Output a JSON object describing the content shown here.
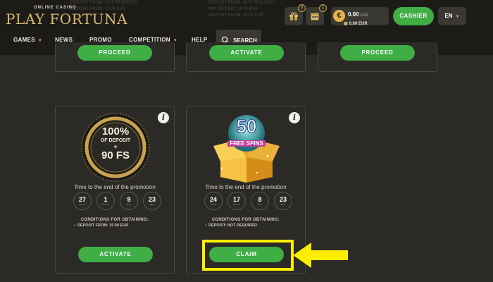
{
  "header": {
    "logo_small": "ONLINE CASINO",
    "logo_big": "PLAY FORTUNA",
    "gift_badge": "0",
    "calendar_badge": "1",
    "balance_amount": "0.00",
    "balance_currency": "EUR",
    "bonus_balance": "0.00 EUR",
    "cashier_label": "CASHIER",
    "language": "EN",
    "faded_rows_left": [
      "DEPOSIT FROM: NOT REQUIRED",
      "DEPOSIT FROM: 10.00 EUR"
    ],
    "faded_rows_mid": [
      "DEPOSIT FROM: NOT REQUIRED",
      "MIN DEPOSIT: 10.00 EUR",
      "DEPOSIT FROM: 10.00 EUR"
    ]
  },
  "nav": {
    "games": "GAMES",
    "news": "NEWS",
    "promo": "PROMO",
    "competition": "COMPETITION",
    "help": "HELP",
    "search": "SEARCH"
  },
  "top_cards": [
    {
      "button": "PROCEED"
    },
    {
      "button": "ACTIVATE"
    },
    {
      "button": "PROCEED"
    }
  ],
  "card1": {
    "badge_line1": "100%",
    "badge_line2": "OF DEPOSIT",
    "badge_line3": "+",
    "badge_line4": "90 FS",
    "timer_title": "Time to the end of the promotion",
    "timers": [
      {
        "value": "27",
        "unit": "DAYS"
      },
      {
        "value": "1",
        "unit": "HOUR"
      },
      {
        "value": "9",
        "unit": "MIN"
      },
      {
        "value": "23",
        "unit": "SEC"
      }
    ],
    "conditions_title": "CONDITIONS FOR OBTAINING:",
    "condition": "DEPOSIT FROM: 10.00 EUR",
    "button": "ACTIVATE"
  },
  "card2": {
    "badge_number": "50",
    "badge_text": "FREE SPINS",
    "timer_title": "Time to the end of the promotion",
    "timers": [
      {
        "value": "24",
        "unit": "DAYS"
      },
      {
        "value": "17",
        "unit": "HOUR"
      },
      {
        "value": "8",
        "unit": "MIN"
      },
      {
        "value": "23",
        "unit": "SEC"
      }
    ],
    "conditions_title": "CONDITIONS FOR OBTAINING:",
    "condition": "DEPOSIT: NOT REQUIRED",
    "button": "CLAIM"
  },
  "colors": {
    "accent_green": "#3fae45",
    "gold": "#d8b870",
    "highlight_yellow": "#ffee00"
  }
}
